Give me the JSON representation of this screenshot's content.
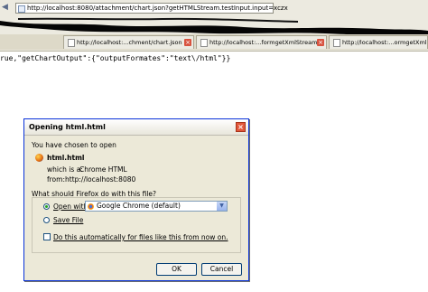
{
  "browser": {
    "url": "http://localhost:8080/attachment/chart.json?getHTMLStream.testInput.input=xczx",
    "tabs": [
      {
        "label": "http://localhost:...chment/chart.json"
      },
      {
        "label": "http://localhost:...formgetXmlStream"
      },
      {
        "label": "http://localhost:...ormgetXmlStrea"
      }
    ]
  },
  "page": {
    "content_text": "rue,\"getChartOutput\":{\"outputFormates\":\"text\\/html\"}}"
  },
  "dialog": {
    "title": "Opening html.html",
    "chosen_label": "You have chosen to open",
    "file_name": "html.html",
    "which_is_label": "which is a:",
    "which_is_value": "Chrome HTML",
    "from_label": "from:",
    "from_value": "http://localhost:8080",
    "question": "What should Firefox do with this file?",
    "open_with_label": "Open with",
    "open_with_app": "Google Chrome (default)",
    "save_file_label": "Save File",
    "auto_label": "Do this automatically for files like this from now on.",
    "ok_label": "OK",
    "cancel_label": "Cancel"
  }
}
